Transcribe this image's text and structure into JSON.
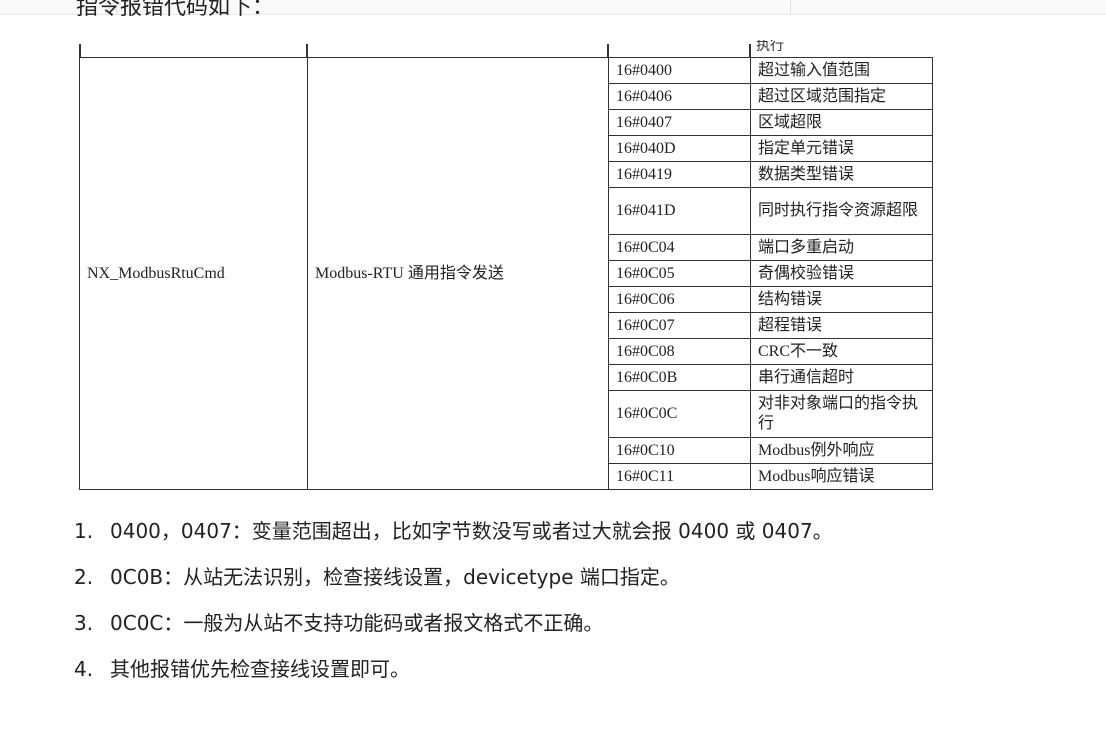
{
  "intro": "指令报错代码如下：",
  "partial_above": "执行",
  "table": {
    "function_name": "NX_ModbusRtuCmd",
    "function_desc": "Modbus-RTU 通用指令发送",
    "rows": [
      {
        "code": "16#0400",
        "msg": "超过输入值范围"
      },
      {
        "code": "16#0406",
        "msg": "超过区域范围指定"
      },
      {
        "code": "16#0407",
        "msg": "区域超限"
      },
      {
        "code": "16#040D",
        "msg": "指定单元错误"
      },
      {
        "code": "16#0419",
        "msg": "数据类型错误"
      },
      {
        "code": "16#041D",
        "msg": "同时执行指令资源超限"
      },
      {
        "code": "16#0C04",
        "msg": "端口多重启动"
      },
      {
        "code": "16#0C05",
        "msg": "奇偶校验错误"
      },
      {
        "code": "16#0C06",
        "msg": "结构错误"
      },
      {
        "code": "16#0C07",
        "msg": "超程错误"
      },
      {
        "code": "16#0C08",
        "msg": "CRC不一致"
      },
      {
        "code": "16#0C0B",
        "msg": "串行通信超时"
      },
      {
        "code": "16#0C0C",
        "msg": "对非对象端口的指令执行"
      },
      {
        "code": "16#0C10",
        "msg": "Modbus例外响应"
      },
      {
        "code": "16#0C11",
        "msg": "Modbus响应错误"
      }
    ]
  },
  "notes": [
    {
      "num": "1.",
      "text": "0400，0407：变量范围超出，比如字节数没写或者过大就会报 0400 或 0407。"
    },
    {
      "num": "2.",
      "text": "0C0B：从站无法识别，检查接线设置，devicetype 端口指定。"
    },
    {
      "num": "3.",
      "text": "0C0C：一般为从站不支持功能码或者报文格式不正确。"
    },
    {
      "num": "4.",
      "text": "其他报错优先检查接线设置即可。"
    }
  ]
}
